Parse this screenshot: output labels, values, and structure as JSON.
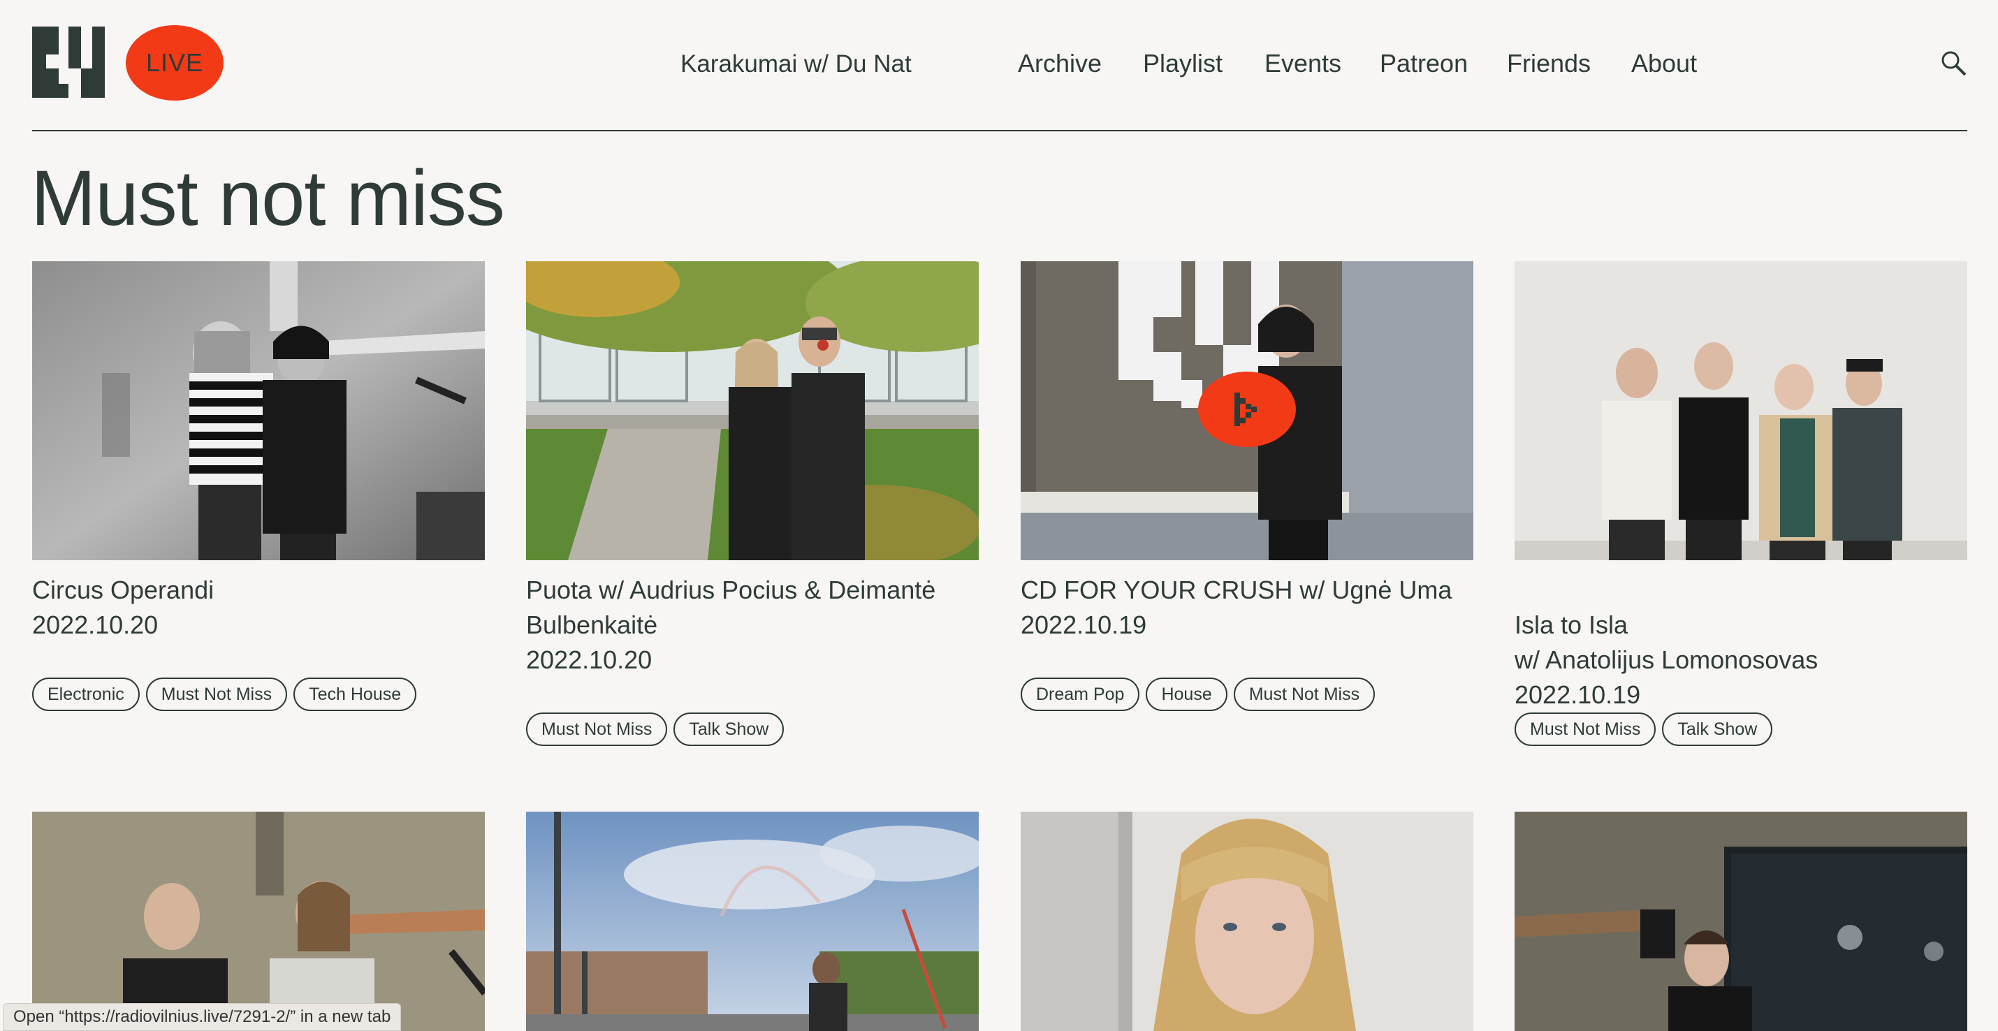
{
  "header": {
    "live_label": "LIVE",
    "now_playing": "Karakumai w/ Du Nat",
    "nav": [
      "Archive",
      "Playlist",
      "Events",
      "Patreon",
      "Friends",
      "About"
    ]
  },
  "page_title": "Must not miss",
  "cards": [
    {
      "title": "Circus Operandi",
      "date": "2022.10.20",
      "tags": [
        "Electronic",
        "Must Not Miss",
        "Tech House"
      ]
    },
    {
      "title": "Puota w/ Audrius Pocius & Deimantė Bulbenkaitė",
      "date": "2022.10.20",
      "tags": [
        "Must Not Miss",
        "Talk Show"
      ]
    },
    {
      "title": "CD FOR YOUR CRUSH w/ Ugnė Uma",
      "date": "2022.10.19",
      "tags": [
        "Dream Pop",
        "House",
        "Must Not Miss"
      ]
    },
    {
      "title": "Isla to Isla\nw/ Anatolijus Lomonosovas",
      "date": "2022.10.19",
      "tags": [
        "Must Not Miss",
        "Talk Show"
      ]
    }
  ],
  "status_bar": "Open “https://radiovilnius.live/7291-2/” in a new tab",
  "colors": {
    "accent": "#f23a16",
    "ink": "#2e3b37",
    "background": "#f8f6f4"
  }
}
